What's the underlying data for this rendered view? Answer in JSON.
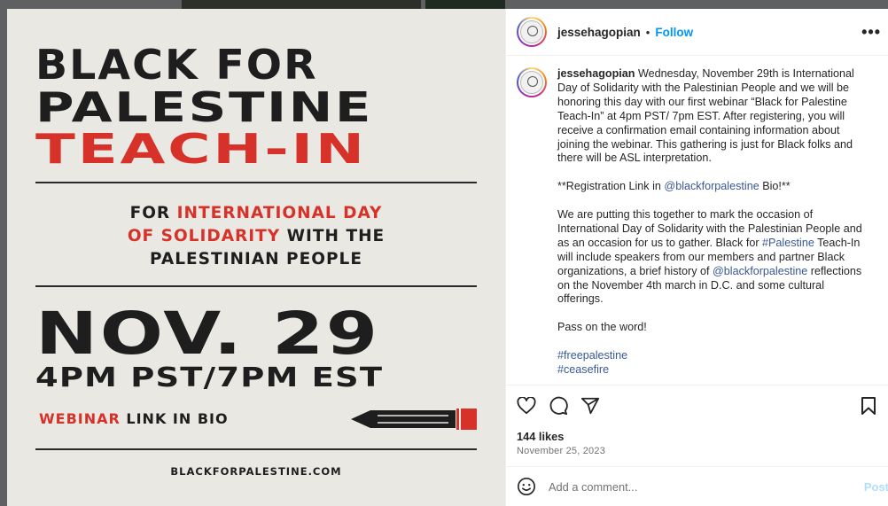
{
  "poster": {
    "title_line1": "BLACK FOR",
    "title_line2": "PALESTINE",
    "title_line3": "TEACH-IN",
    "sub_line1_a": "FOR ",
    "sub_line1_b": "INTERNATIONAL DAY",
    "sub_line2_a": "OF SOLIDARITY",
    "sub_line2_b": " WITH THE",
    "sub_line3": "PALESTINIAN PEOPLE",
    "date": "NOV. 29",
    "time": "4PM PST/7PM EST",
    "webinar_a": "WEBINAR",
    "webinar_b": " LINK IN BIO",
    "site": "BLACKFORPALESTINE.COM",
    "colors": {
      "red": "#d7322a",
      "ink": "#1e1e1e",
      "paper": "#eae8e3"
    }
  },
  "header": {
    "username": "jessehagopian",
    "separator": "•",
    "follow_label": "Follow",
    "more_icon": "more-horizontal-icon"
  },
  "caption": {
    "username": "jessehagopian",
    "para1": "Wednesday, November 29th is International Day of Solidarity with the Palestinian People and we will be honoring this day with our first webinar “Black for Palestine Teach-In” at 4pm PST/ 7pm EST. After registering, you will receive a confirmation email containing information about joining the webinar. This gathering is just for Black folks and there will be ASL interpretation.",
    "para2_a": "**Registration Link in ",
    "para2_mention": "@blackforpalestine",
    "para2_b": " Bio!**",
    "para3_a": "We are putting this together to mark the occasion of International Day of Solidarity with the Palestinian People and as an occasion for us to gather. Black for ",
    "para3_tag": "#Palestine",
    "para3_b": " Teach-In will include speakers from our members and partner Black organizations, a brief history of ",
    "para3_mention": "@blackforpalestine",
    "para3_c": " reflections on the November 4th march in D.C. and some cultural offerings.",
    "para4": "Pass on the word!",
    "hashtag1": "#freepalestine",
    "hashtag2": "#ceasefire"
  },
  "actions": {
    "likes": "144 likes",
    "date": "November 25, 2023"
  },
  "comment": {
    "placeholder": "Add a comment...",
    "post_label": "Post"
  }
}
